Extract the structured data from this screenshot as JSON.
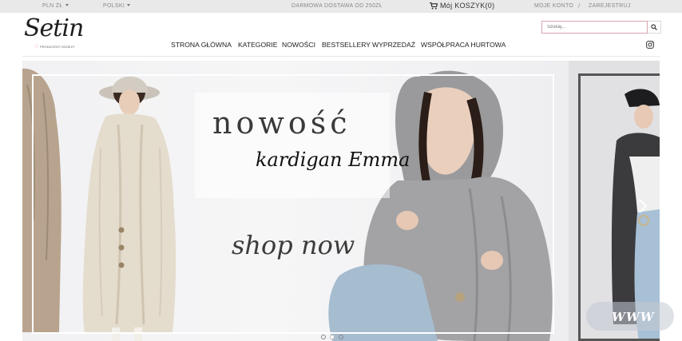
{
  "topbar": {
    "currency": "PLN ZŁ",
    "language": "POLSKI",
    "shipping_note": "DARMOWA DOSTAWA OD 250ZŁ",
    "cart_label": "Mój KOSZYK(0)",
    "account": "MOJE KONTO",
    "separator": "/",
    "register": "ZAREJESTRUJ"
  },
  "logo": {
    "name": "Setin",
    "tagline": "PRODUCENT ODZIEŻY"
  },
  "search": {
    "placeholder": "Szukaj..."
  },
  "nav": {
    "items": [
      "STRONA GŁÓWNA",
      "KATEGORIE",
      "NOWOŚCI",
      "BESTSELLERY",
      "WYPRZEDAŻ",
      "WSPÓŁPRACA HURTOWA"
    ]
  },
  "hero": {
    "headline": "nowość",
    "subline": "kardigan Emma",
    "cta": "shop now",
    "slides_count": 3,
    "active_slide": 1
  },
  "overlay": {
    "badge": "WWW"
  },
  "icons": {
    "cart": "cart-icon",
    "search": "search-icon",
    "social": "instagram-icon",
    "next": "chevron-right-icon"
  },
  "colors": {
    "topbar_bg": "#e9e9e9",
    "search_border": "#d9a3ad",
    "heart": "#e05a8a"
  }
}
